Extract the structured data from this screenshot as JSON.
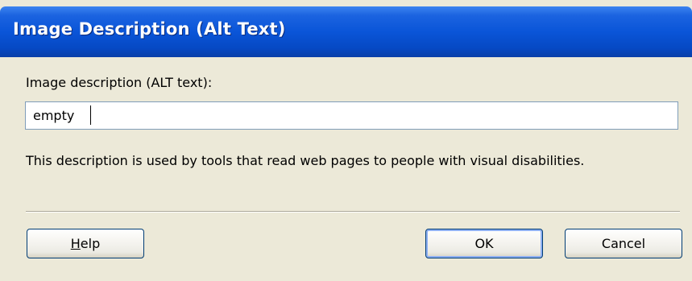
{
  "window": {
    "title": "Image Description (Alt Text)"
  },
  "form": {
    "label": "Image description (ALT text):",
    "input_value": "empty",
    "help_text": "This description is used by tools that read web pages to people with visual disabilities."
  },
  "buttons": {
    "help_mnemonic": "H",
    "help_rest": "elp",
    "ok_label": "OK",
    "cancel_label": "Cancel"
  },
  "colors": {
    "titlebar": "#0a55d8",
    "dialog_bg": "#ece9d8",
    "button_border": "#003c74"
  }
}
